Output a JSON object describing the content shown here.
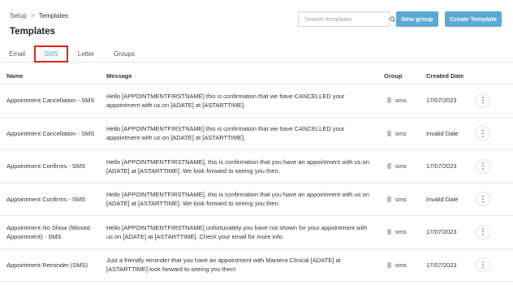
{
  "breadcrumb": {
    "parent": "Setup",
    "separator": ">",
    "current": "Templates"
  },
  "page": {
    "title": "Templates"
  },
  "search": {
    "placeholder": "Search templates"
  },
  "buttons": {
    "new_group": "New group",
    "create_template": "Create Template"
  },
  "tabs": [
    {
      "label": "Email",
      "active": false
    },
    {
      "label": "SMS",
      "active": true
    },
    {
      "label": "Letter",
      "active": false
    },
    {
      "label": "Groups",
      "active": false
    }
  ],
  "table": {
    "headers": {
      "name": "Name",
      "message": "Message",
      "group": "Group",
      "created": "Created Date"
    },
    "rows": [
      {
        "name": "Appointment Cancellation - SMS",
        "message": "Hello [APPOINTMENTFIRSTNAME] this is confirmation that we have CANCELLED your appointment with us on [ADATE] at [ASTARTTIME].",
        "group": "sms",
        "created": "17/07/2023"
      },
      {
        "name": "Appointment Cancellation - SMS",
        "message": "Hello [APPOINTMENTFIRSTNAME] this is confirmation that we have CANCELLED your appointment with us on [ADATE] at [ASTARTTIME].",
        "group": "sms",
        "created": "Invalid Date"
      },
      {
        "name": "Appointment Confirms - SMS",
        "message": "Hello [APPOINTMENTFIRSTNAME], this is confirmation that you have an appointment with us on [ADATE] at [ASTARTTIME]. We look forward to seeing you then.",
        "group": "sms",
        "created": "17/07/2023"
      },
      {
        "name": "Appointment Confirms - SMS",
        "message": "Hello [APPOINTMENTFIRSTNAME], this is confirmation that you have an appointment with us on [ADATE] at [ASTARTTIME]. We look forward to seeing you then.",
        "group": "sms",
        "created": "Invalid Date"
      },
      {
        "name": "Appointment No Show (Missed Appointment) - SMS",
        "message": "Hello [APPOINTMENTFIRSTNAME] unfortunately you have not shown for your appointment with us on [ADATE] at [ASTARTTIME]. Check your email for more info.",
        "group": "sms",
        "created": "17/07/2023"
      },
      {
        "name": "Appointment Reminder (SMS)",
        "message": "Just a friendly reminder that you have an appointment with Maniera Clinical [ADATE] at [ASTARTTIME] look forward to seeing you then!",
        "group": "sms",
        "created": "17/07/2023"
      }
    ]
  },
  "colors": {
    "accent": "#5aaad6",
    "tab_active": "#4a9fd4",
    "highlight_border": "#e0241b"
  },
  "icons": {
    "search": "search-icon",
    "group": "document-icon",
    "more": "more-vertical-icon"
  }
}
